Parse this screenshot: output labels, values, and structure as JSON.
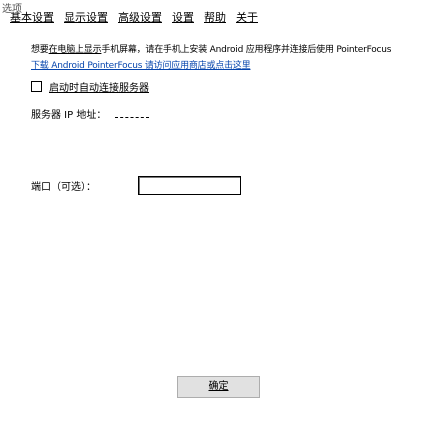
{
  "window": {
    "title": "选项"
  },
  "menu": [
    "基本设置",
    "显示设置",
    "高级设置",
    "设置",
    "帮助",
    "关于"
  ],
  "info": {
    "line1_prefix": "想要",
    "line1_link": "在电脑上显示",
    "line1_text": "手机屏幕，请在手机上安装 Android 应用程序并连接后使用 PointerFocus",
    "line2_text": "下载 Android PointerFocus 请访问应用商店或点击这里"
  },
  "checkbox": {
    "label": "启动时自动连接服务器",
    "checked": false
  },
  "ip": {
    "label": "服务器 IP 地址：",
    "value": ""
  },
  "port": {
    "label": "端口（可选）：",
    "value": ""
  },
  "ok_button": {
    "label": "确定"
  }
}
